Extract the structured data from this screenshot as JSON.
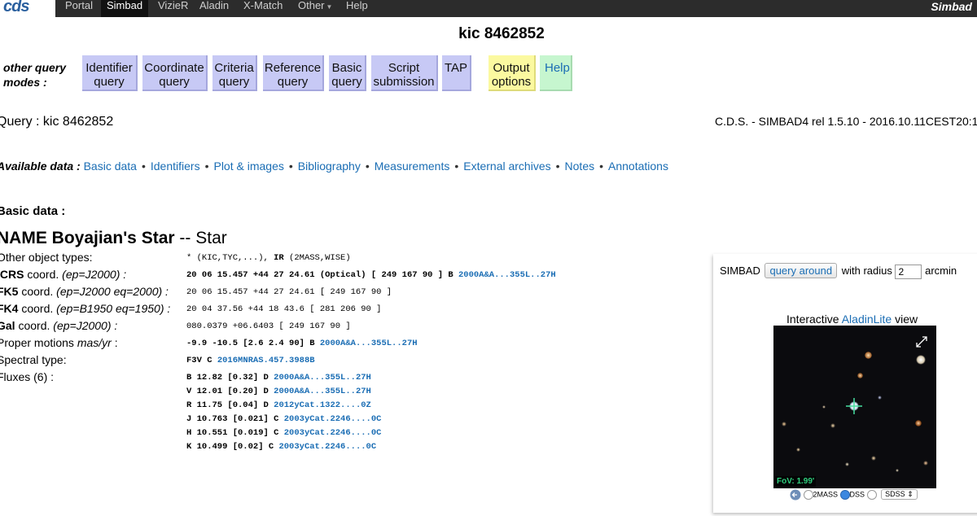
{
  "topbar": {
    "logo_text": "cds",
    "nav": [
      "Portal",
      "Simbad",
      "VizieR",
      "Aladin",
      "X-Match",
      "Other",
      "Help"
    ],
    "active": "Simbad",
    "brand": "Simbad"
  },
  "title": "kic 8462852",
  "modes": {
    "label": "other query modes :",
    "buttons": {
      "identifier": "Identifier query",
      "coordinate": "Coordinate query",
      "criteria": "Criteria query",
      "reference": "Reference query",
      "basic": "Basic query",
      "script": "Script submission",
      "tap": "TAP",
      "output": "Output options",
      "help": "Help"
    }
  },
  "query": {
    "label": "Query :",
    "value": "kic 8462852"
  },
  "version": "C.D.S. - SIMBAD4 rel 1.5.10 - 2016.10.11CEST20:1",
  "available": {
    "label": "Available data :",
    "links": [
      "Basic data",
      "Identifiers",
      "Plot & images",
      "Bibliography",
      "Measurements",
      "External archives",
      "Notes",
      "Annotations"
    ]
  },
  "basic_data_heading": "Basic data :",
  "object": {
    "name": "NAME Boyajian's Star",
    "sep": "--",
    "type": "Star"
  },
  "rows": {
    "other_types": {
      "label": "Other object types:",
      "value_pre": "* (KIC,TYC,...), ",
      "value_bold": "IR",
      "value_post": " (2MASS,WISE)"
    },
    "icrs": {
      "label_b": "ICRS",
      "label_t": " coord. ",
      "label_i": "(ep=J2000) :",
      "value": "20 06 15.457 +44 27 24.61 (Optical) [ 249 167 90 ] B",
      "ref": "2000A&A...355L..27H"
    },
    "fk5": {
      "label_b": "FK5",
      "label_t": " coord. ",
      "label_i": "(ep=J2000 eq=2000) :",
      "value": "20 06 15.457 +44 27 24.61 [ 249 167 90 ]"
    },
    "fk4": {
      "label_b": "FK4",
      "label_t": " coord. ",
      "label_i": "(ep=B1950 eq=1950) :",
      "value": "20 04 37.56 +44 18 43.6 [ 281 206 90 ]"
    },
    "gal": {
      "label_b": "Gal",
      "label_t": " coord. ",
      "label_i": "(ep=J2000) :",
      "value": "080.0379 +06.6403 [ 249 167 90 ]"
    },
    "pm": {
      "label_t": "Proper motions ",
      "label_i": "mas/yr",
      "label_post": " :",
      "value": "-9.9 -10.5 [2.6 2.4 90] B",
      "ref": "2000A&A...355L..27H"
    },
    "spectral": {
      "label": "Spectral type:",
      "value": "F3V C",
      "ref": "2016MNRAS.457.3988B"
    },
    "fluxes": {
      "label": "Fluxes (6) :"
    }
  },
  "fluxes": [
    {
      "text": "B 12.82 [0.32] D",
      "ref": "2000A&A...355L..27H"
    },
    {
      "text": "V 12.01 [0.20] D",
      "ref": "2000A&A...355L..27H"
    },
    {
      "text": "R 11.75 [0.04] D",
      "ref": "2012yCat.1322....0Z"
    },
    {
      "text": "J 10.763 [0.021] C",
      "ref": "2003yCat.2246....0C"
    },
    {
      "text": "H 10.551 [0.019] C",
      "ref": "2003yCat.2246....0C"
    },
    {
      "text": "K 10.499 [0.02] C",
      "ref": "2003yCat.2246....0C"
    }
  ],
  "panel": {
    "simbad": "SIMBAD",
    "query_around": "query around",
    "with_radius": "with radius",
    "radius_value": "2",
    "unit": "arcmin",
    "aladin_pre": "Interactive ",
    "aladin_link": "AladinLite",
    "aladin_post": " view",
    "fov": "FoV: 1.99'",
    "survey_2mass": "2MASS",
    "survey_dss": "DSS",
    "survey_select": "SDSS",
    "selected_survey": "DSS"
  }
}
